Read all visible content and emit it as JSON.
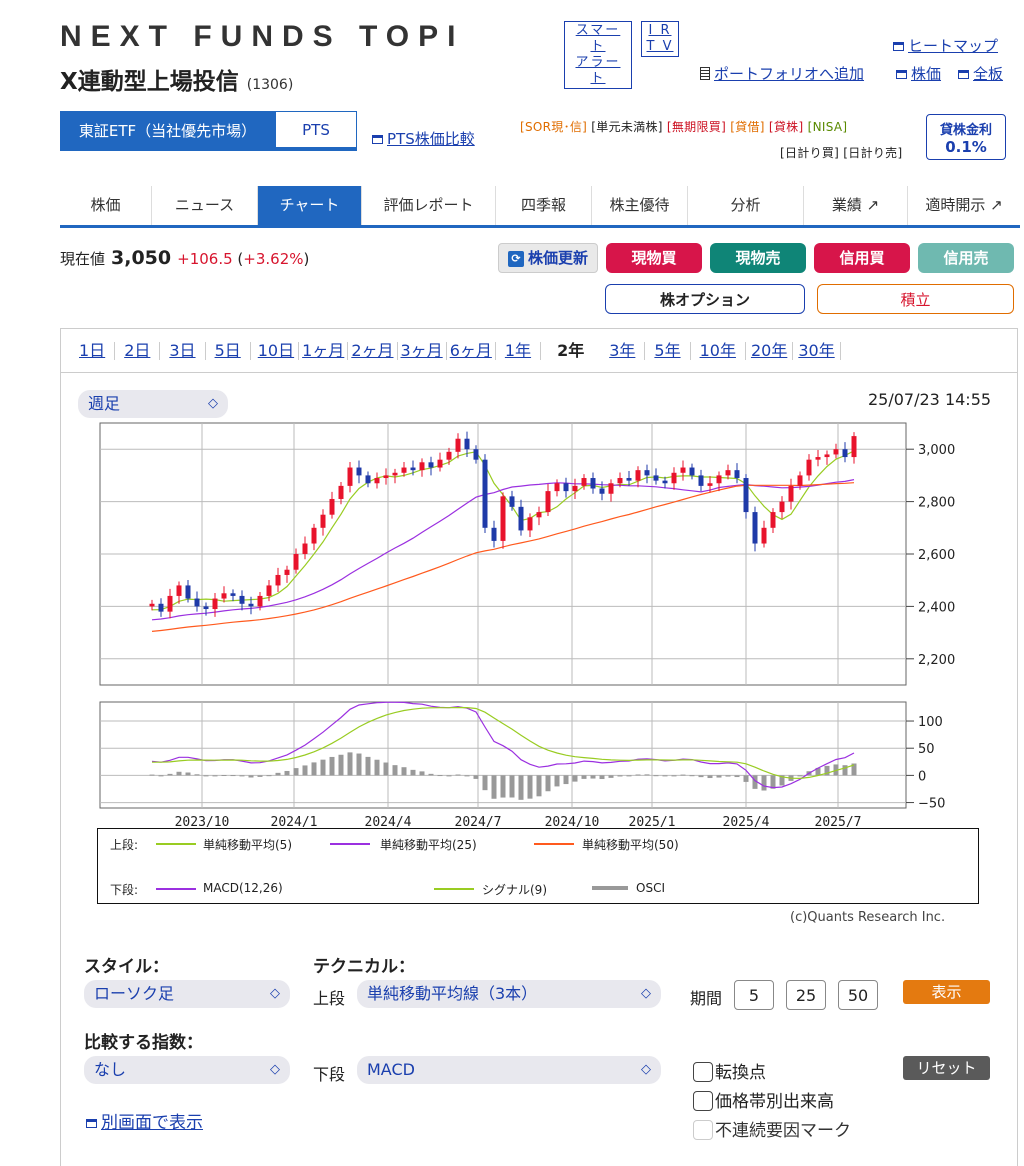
{
  "header": {
    "title_line1": "NEXT FUNDS TOPI",
    "title_line2": "X連動型上場投信",
    "code": "(1306)",
    "smart_alert": [
      "スマート",
      "アラート"
    ],
    "ir_tv": [
      "I R",
      "T V"
    ],
    "heatmap": "ヒートマップ",
    "portfolio_add": "ポートフォリオへ追加",
    "stock_price": "株価",
    "full_board": "全板"
  },
  "market": {
    "tab_tse": "東証ETF（当社優先市場）",
    "tab_pts": "PTS",
    "pts_compare": "PTS株価比較",
    "tags_line1": [
      "[SOR現･信]",
      "[単元未満株]",
      "[無期限買]",
      "[貸借]",
      "[貸株]",
      "[NISA]"
    ],
    "tags_line2": [
      "[日計り買]",
      "[日計り売]"
    ],
    "lending_label": "貸株金利",
    "lending_rate": "0.1%"
  },
  "nav": {
    "tabs": [
      "株価",
      "ニュース",
      "チャート",
      "評価レポート",
      "四季報",
      "株主優待",
      "分析",
      "業績 ↗",
      "適時開示 ↗"
    ],
    "active": "チャート"
  },
  "quote": {
    "label": "現在値",
    "price": "3,050",
    "change": "+106.5",
    "change_pct_prefix": "(",
    "change_pct": "+3.62%",
    "change_pct_suffix": ")",
    "refresh": "株価更新",
    "buy_spot": "現物買",
    "sell_spot": "現物売",
    "buy_margin": "信用買",
    "sell_margin": "信用売",
    "option": "株オプション",
    "accumulate": "積立"
  },
  "colors": {
    "buy_spot": "#d7154a",
    "sell_spot": "#0f8577",
    "buy_margin": "#d7154a",
    "sell_margin": "#6fb9b0",
    "up_candle": "#e8132c",
    "down_candle": "#1f3aa8",
    "sma5": "#99cc22",
    "sma25": "#9b30e0",
    "sma50": "#ff5a1e"
  },
  "periods": [
    "1日",
    "2日",
    "3日",
    "5日",
    "10日",
    "1ヶ月",
    "2ヶ月",
    "3ヶ月",
    "6ヶ月",
    "1年",
    "2年",
    "3年",
    "5年",
    "10年",
    "20年",
    "30年"
  ],
  "period_active": "2年",
  "chart_controls": {
    "interval": "週足",
    "timestamp": "25/07/23 14:55",
    "copyright": "(c)Quants Research Inc."
  },
  "chart_data": [
    {
      "type": "candlestick",
      "interval": "weekly",
      "x_tick_labels": [
        "2023/10",
        "2024/1",
        "2024/4",
        "2024/7",
        "2024/10",
        "2025/1",
        "2025/4",
        "2025/7"
      ],
      "y_tick_labels": [
        "3,000",
        "2,800",
        "2,600",
        "2,400",
        "2,200"
      ],
      "ylim": [
        2100,
        3100
      ],
      "grid": true,
      "close_approx": [
        2410,
        2380,
        2440,
        2480,
        2430,
        2400,
        2390,
        2430,
        2450,
        2440,
        2410,
        2400,
        2440,
        2480,
        2520,
        2540,
        2600,
        2640,
        2700,
        2750,
        2810,
        2860,
        2930,
        2900,
        2870,
        2890,
        2900,
        2910,
        2930,
        2920,
        2950,
        2930,
        2960,
        2990,
        3040,
        3000,
        2960,
        2700,
        2650,
        2820,
        2780,
        2690,
        2740,
        2760,
        2840,
        2870,
        2840,
        2860,
        2890,
        2850,
        2830,
        2870,
        2890,
        2880,
        2920,
        2900,
        2880,
        2870,
        2910,
        2930,
        2900,
        2860,
        2870,
        2900,
        2920,
        2890,
        2760,
        2640,
        2700,
        2760,
        2800,
        2860,
        2900,
        2960,
        2970,
        2980,
        3000,
        2970,
        3050
      ],
      "series": [
        {
          "name": "単純移動平均(5)"
        },
        {
          "name": "単純移動平均(25)"
        },
        {
          "name": "単純移動平均(50)"
        }
      ]
    },
    {
      "type": "line",
      "y_tick_labels": [
        "100",
        "50",
        "0",
        "−50"
      ],
      "ylim": [
        -60,
        135
      ],
      "series": [
        {
          "name": "MACD(12,26)"
        },
        {
          "name": "シグナル(9)"
        },
        {
          "name": "OSCI"
        }
      ]
    }
  ],
  "legend": {
    "upper_label": "上段:",
    "lower_label": "下段:",
    "upper": [
      "単純移動平均(5)",
      "単純移動平均(25)",
      "単純移動平均(50)"
    ],
    "lower": [
      "MACD(12,26)",
      "シグナル(9)",
      "OSCI"
    ]
  },
  "controls": {
    "style_label": "スタイル：",
    "style_value": "ローソク足",
    "technical_label": "テクニカル：",
    "upper_label": "上段",
    "upper_value": "単純移動平均線（3本）",
    "period_label": "期間",
    "periods": [
      "5",
      "25",
      "50"
    ],
    "show": "表示",
    "compare_label": "比較する指数：",
    "compare_value": "なし",
    "lower_label": "下段",
    "lower_value": "MACD",
    "turning_point": "転換点",
    "volume_by_price": "価格帯別出来高",
    "discontinuity": "不連続要因マーク",
    "reset": "リセット",
    "separate_window": "別画面で表示"
  }
}
